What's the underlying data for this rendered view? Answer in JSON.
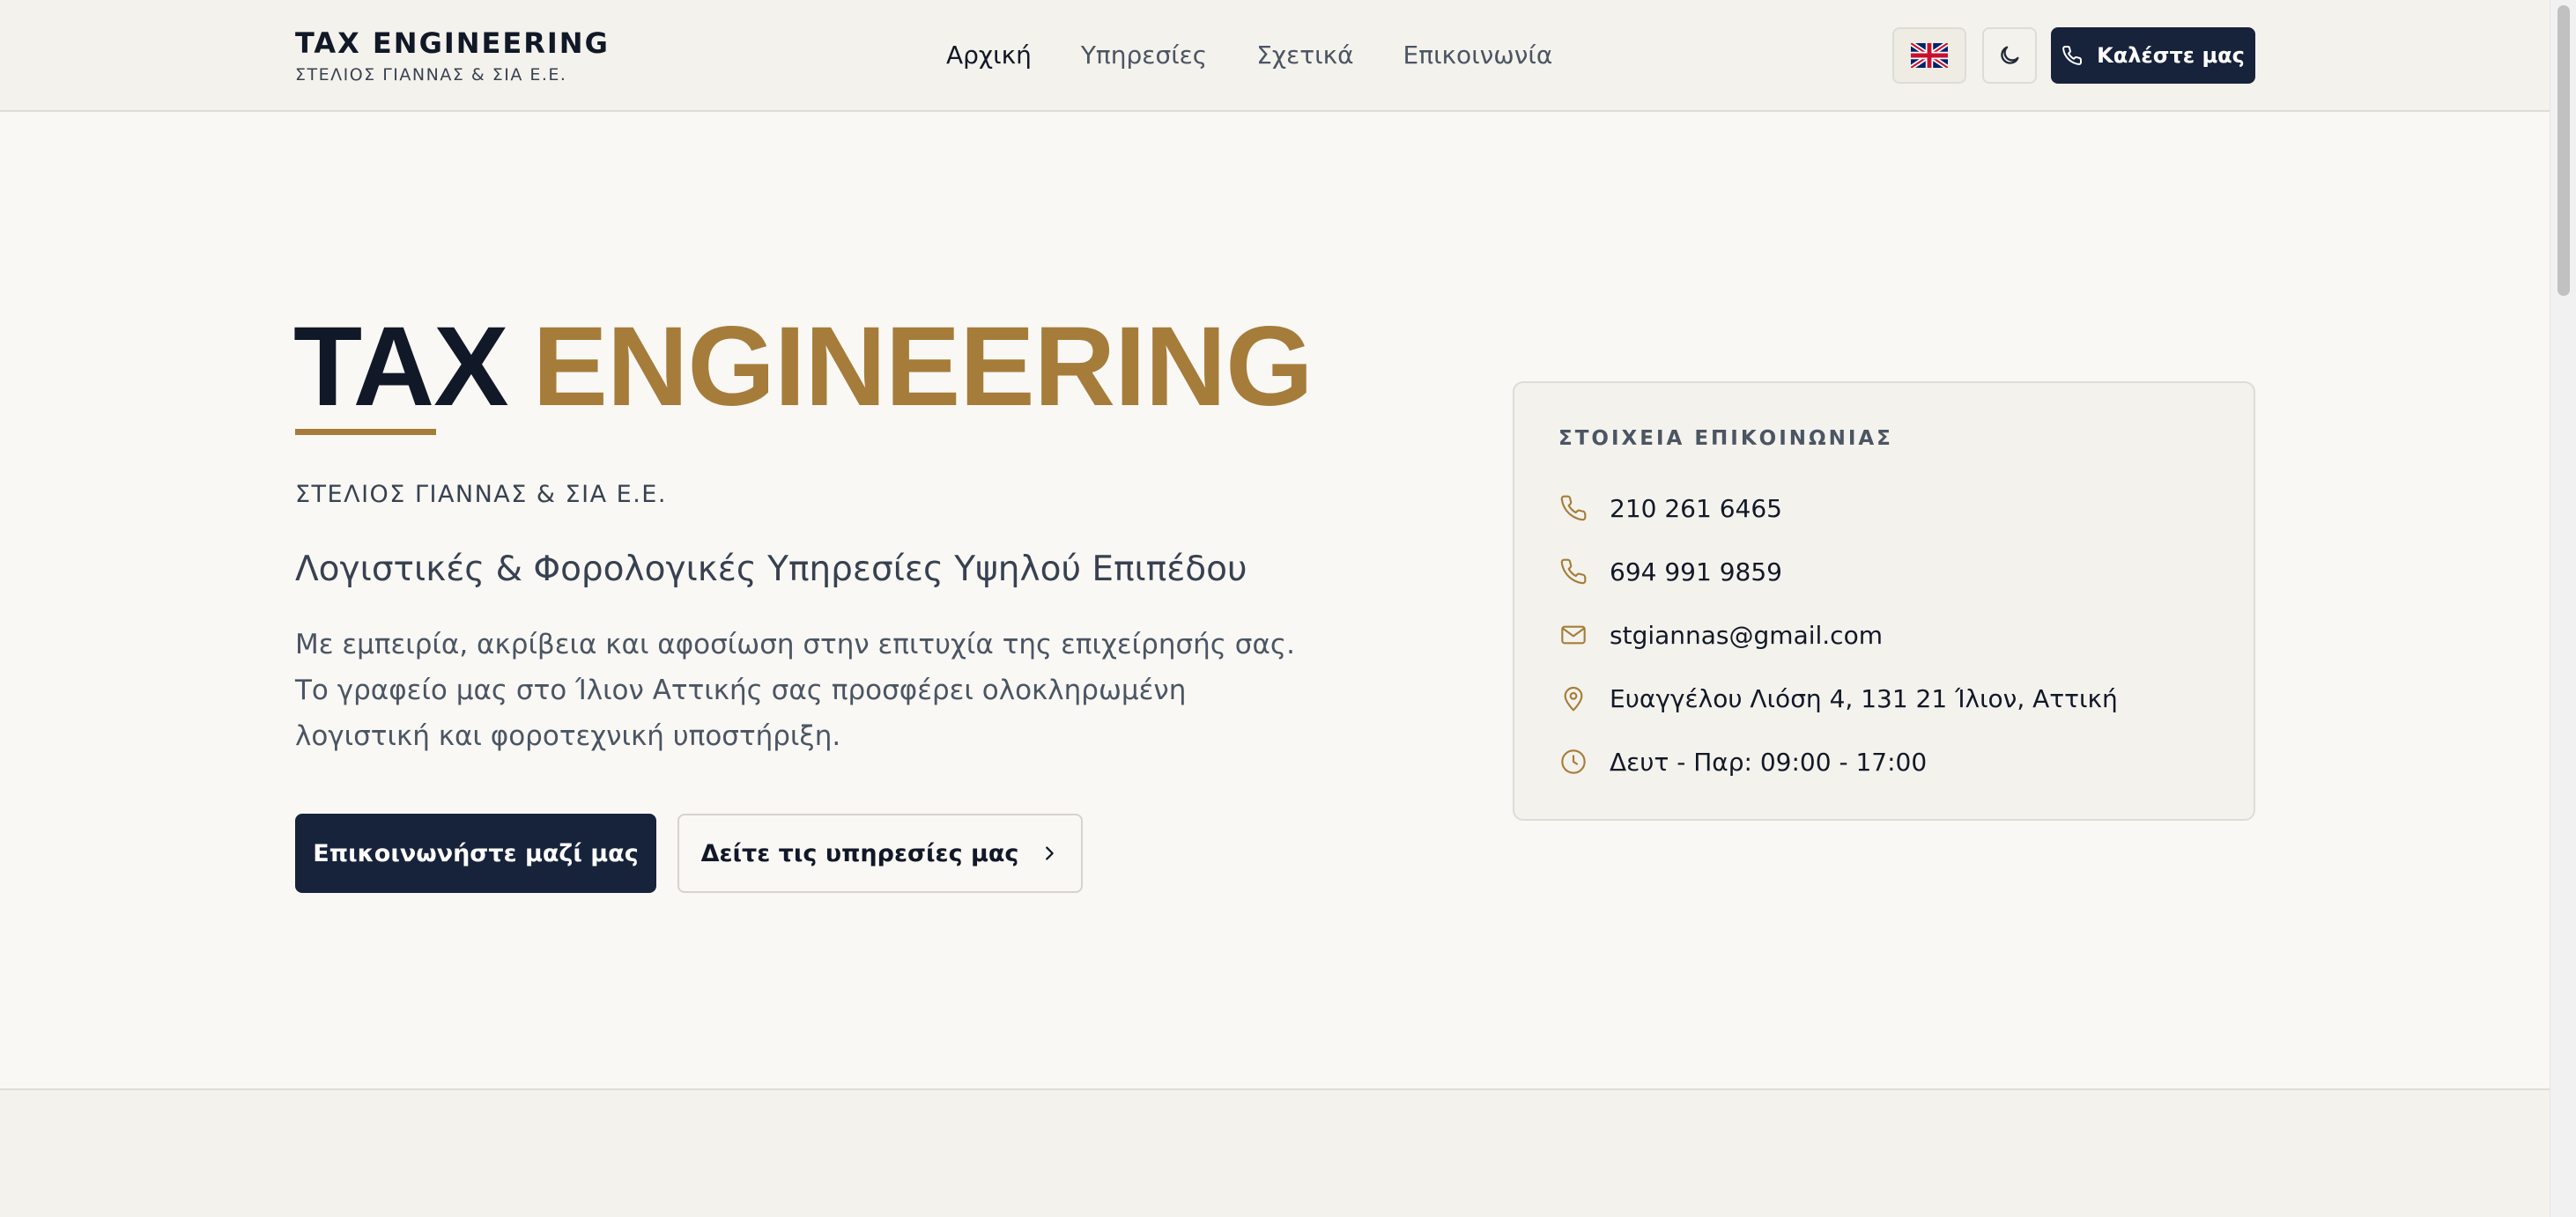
{
  "header": {
    "brand_title": "TAX ENGINEERING",
    "brand_subtitle": "ΣΤΕΛΙΟΣ ΓΙΑΝΝΑΣ & ΣΙΑ Ε.Ε.",
    "nav": [
      "Αρχική",
      "Υπηρεσίες",
      "Σχετικά",
      "Επικοινωνία"
    ],
    "language_icon": "uk-flag-icon",
    "theme_icon": "moon-icon",
    "call_label": "Καλέστε μας"
  },
  "hero": {
    "title_part1": "TAX",
    "title_part2": "ENGINEERING",
    "company": "ΣΤΕΛΙΟΣ ΓΙΑΝΝΑΣ & ΣΙΑ Ε.Ε.",
    "tagline": "Λογιστικές & Φορολογικές Υπηρεσίες Υψηλού Επιπέδου",
    "description": "Με εμπειρία, ακρίβεια και αφοσίωση στην επιτυχία της επιχείρησής σας. Το γραφείο μας στο Ίλιον Αττικής σας προσφέρει ολοκληρωμένη λογιστική και φοροτεχνική υποστήριξη.",
    "primary_cta": "Επικοινωνήστε μαζί μας",
    "secondary_cta": "Δείτε τις υπηρεσίες μας"
  },
  "contact": {
    "title": "ΣΤΟΙΧΕΙΑ ΕΠΙΚΟΙΝΩΝΙΑΣ",
    "phone1": "210 261 6465",
    "phone2": "694 991 9859",
    "email": "stgiannas@gmail.com",
    "address": "Ευαγγέλου Λιόση 4, 131 21 Ίλιον, Αττική",
    "hours": "Δευτ - Παρ: 09:00 - 17:00"
  },
  "colors": {
    "accent": "#a67c3a",
    "navy": "#17223b",
    "background": "#f9f8f5"
  }
}
